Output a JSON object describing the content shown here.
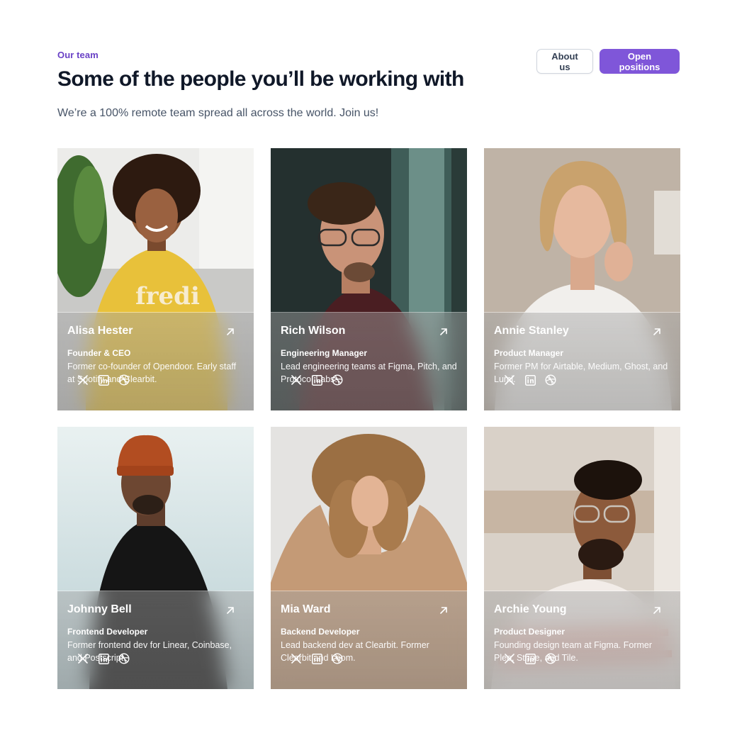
{
  "header": {
    "eyebrow": "Our team",
    "title": "Some of the people you’ll be working with",
    "subtitle": "We’re a 100% remote team spread all across the world. Join us!",
    "about_label": "About us",
    "open_positions_label": "Open positions"
  },
  "colors": {
    "accent": "#7f56d9",
    "eyebrow": "#6941c6",
    "text": "#101828",
    "muted": "#475467"
  },
  "social_icons": [
    "x-icon",
    "linkedin-icon",
    "dribbble-icon"
  ],
  "team": [
    {
      "name": "Alisa Hester",
      "role": "Founder & CEO",
      "bio": "Former co-founder of Opendoor. Early staff at Spotify and Clearbit."
    },
    {
      "name": "Rich Wilson",
      "role": "Engineering Manager",
      "bio": "Lead engineering teams at Figma, Pitch, and Protocol Labs."
    },
    {
      "name": "Annie Stanley",
      "role": "Product Manager",
      "bio": "Former PM for Airtable, Medium, Ghost, and Lumi."
    },
    {
      "name": "Johnny Bell",
      "role": "Frontend Developer",
      "bio": "Former frontend dev for Linear, Coinbase, and Postscript."
    },
    {
      "name": "Mia Ward",
      "role": "Backend Developer",
      "bio": "Lead backend dev at Clearbit. Former Clearbit and Loom."
    },
    {
      "name": "Archie Young",
      "role": "Product Designer",
      "bio": "Founding design team at Figma. Former Pleo, Stripe, and Tile."
    }
  ]
}
